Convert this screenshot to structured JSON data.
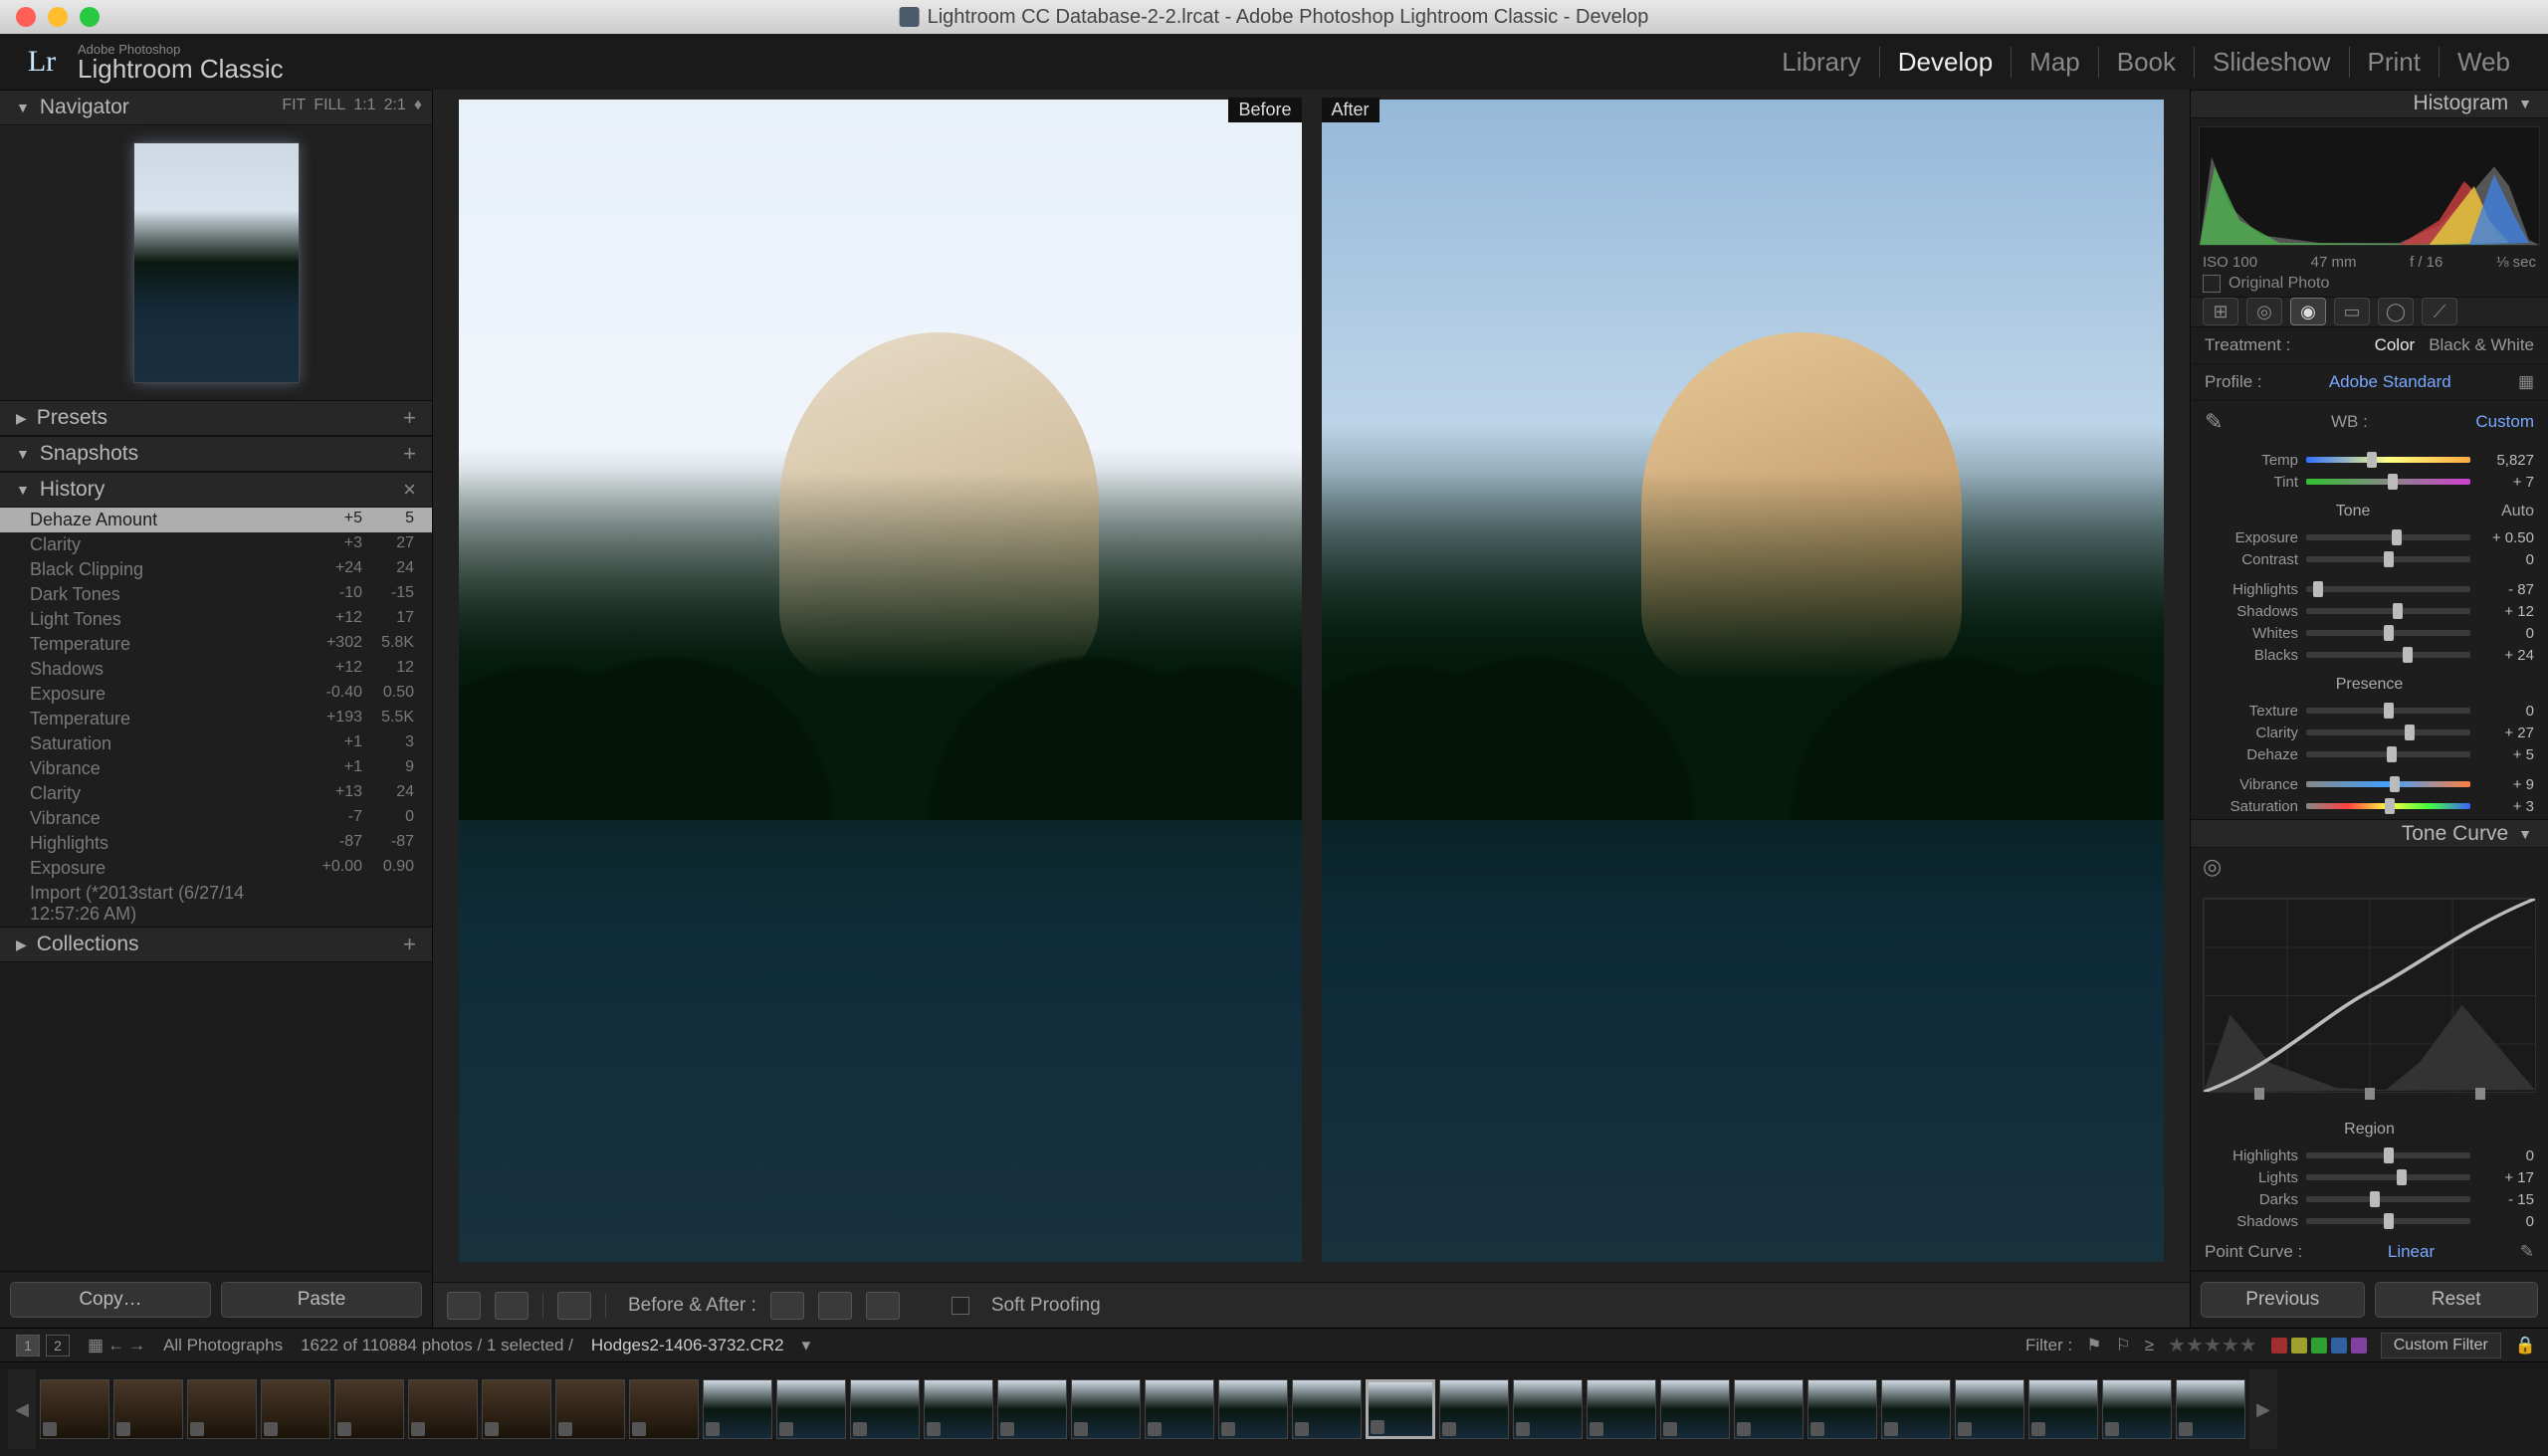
{
  "window_title": "Lightroom CC Database-2-2.lrcat - Adobe Photoshop Lightroom Classic - Develop",
  "brand": {
    "small": "Adobe Photoshop",
    "big": "Lightroom Classic",
    "logo": "Lr"
  },
  "modules": [
    "Library",
    "Develop",
    "Map",
    "Book",
    "Slideshow",
    "Print",
    "Web"
  ],
  "active_module": "Develop",
  "left": {
    "navigator": {
      "label": "Navigator",
      "zoom": [
        "FIT",
        "FILL",
        "1:1",
        "2:1"
      ]
    },
    "presets": "Presets",
    "snapshots": "Snapshots",
    "history": {
      "label": "History",
      "items": [
        {
          "n": "Dehaze Amount",
          "v1": "+5",
          "v2": "5",
          "active": true
        },
        {
          "n": "Clarity",
          "v1": "+3",
          "v2": "27"
        },
        {
          "n": "Black Clipping",
          "v1": "+24",
          "v2": "24"
        },
        {
          "n": "Dark Tones",
          "v1": "-10",
          "v2": "-15"
        },
        {
          "n": "Light Tones",
          "v1": "+12",
          "v2": "17"
        },
        {
          "n": "Temperature",
          "v1": "+302",
          "v2": "5.8K"
        },
        {
          "n": "Shadows",
          "v1": "+12",
          "v2": "12"
        },
        {
          "n": "Exposure",
          "v1": "-0.40",
          "v2": "0.50"
        },
        {
          "n": "Temperature",
          "v1": "+193",
          "v2": "5.5K"
        },
        {
          "n": "Saturation",
          "v1": "+1",
          "v2": "3"
        },
        {
          "n": "Vibrance",
          "v1": "+1",
          "v2": "9"
        },
        {
          "n": "Clarity",
          "v1": "+13",
          "v2": "24"
        },
        {
          "n": "Vibrance",
          "v1": "-7",
          "v2": "0"
        },
        {
          "n": "Highlights",
          "v1": "-87",
          "v2": "-87"
        },
        {
          "n": "Exposure",
          "v1": "+0.00",
          "v2": "0.90"
        },
        {
          "n": "Import (*2013start (6/27/14 12:57:26 AM)",
          "v1": "",
          "v2": ""
        }
      ]
    },
    "collections": "Collections",
    "copy": "Copy…",
    "paste": "Paste"
  },
  "center": {
    "before": "Before",
    "after": "After",
    "ba_label": "Before & After :",
    "soft": "Soft Proofing"
  },
  "right": {
    "histogram": "Histogram",
    "histo_info": {
      "iso": "ISO 100",
      "focal": "47 mm",
      "ap": "f / 16",
      "sh": "⅛ sec"
    },
    "original": "Original Photo",
    "treatment": {
      "label": "Treatment :",
      "color": "Color",
      "bw": "Black & White"
    },
    "profile": {
      "label": "Profile :",
      "value": "Adobe Standard"
    },
    "wb": {
      "label": "WB :",
      "value": "Custom"
    },
    "temp": {
      "label": "Temp",
      "value": "5,827"
    },
    "tint": {
      "label": "Tint",
      "value": "+ 7"
    },
    "tone": {
      "label": "Tone",
      "auto": "Auto"
    },
    "exposure": {
      "label": "Exposure",
      "value": "+ 0.50"
    },
    "contrast": {
      "label": "Contrast",
      "value": "0"
    },
    "highlights": {
      "label": "Highlights",
      "value": "- 87"
    },
    "shadows": {
      "label": "Shadows",
      "value": "+ 12"
    },
    "whites": {
      "label": "Whites",
      "value": "0"
    },
    "blacks": {
      "label": "Blacks",
      "value": "+ 24"
    },
    "presence": "Presence",
    "texture": {
      "label": "Texture",
      "value": "0"
    },
    "clarity": {
      "label": "Clarity",
      "value": "+ 27"
    },
    "dehaze": {
      "label": "Dehaze",
      "value": "+ 5"
    },
    "vibrance": {
      "label": "Vibrance",
      "value": "+ 9"
    },
    "saturation": {
      "label": "Saturation",
      "value": "+ 3"
    },
    "tonecurve": "Tone Curve",
    "region": "Region",
    "r_highlights": {
      "label": "Highlights",
      "value": "0"
    },
    "r_lights": {
      "label": "Lights",
      "value": "+ 17"
    },
    "r_darks": {
      "label": "Darks",
      "value": "- 15"
    },
    "r_shadows": {
      "label": "Shadows",
      "value": "0"
    },
    "pointcurve": {
      "label": "Point Curve :",
      "value": "Linear"
    },
    "previous": "Previous",
    "reset": "Reset"
  },
  "filmstrip": {
    "source": "All Photographs",
    "count": "1622 of 110884 photos / 1 selected /",
    "file": "Hodges2-1406-3732.CR2",
    "filter_label": "Filter :",
    "custom": "Custom Filter"
  }
}
